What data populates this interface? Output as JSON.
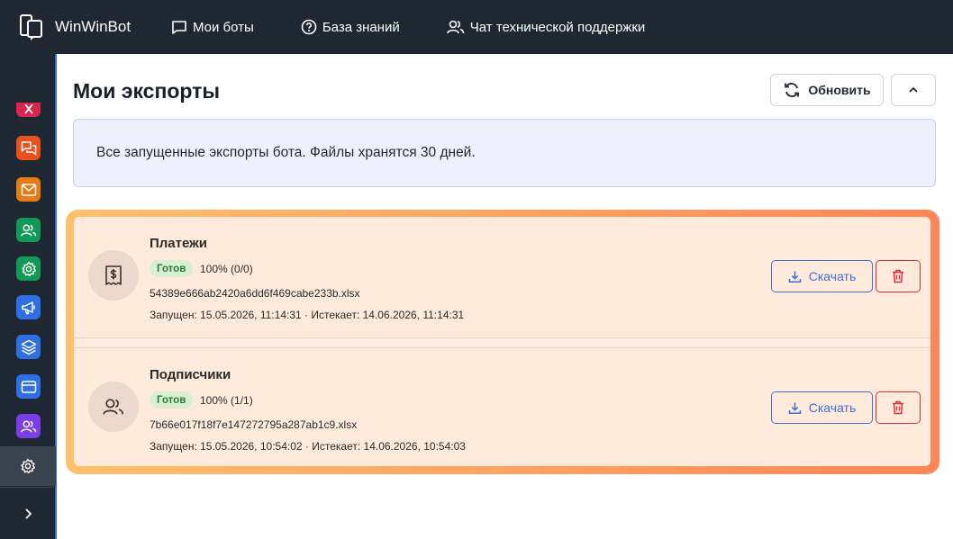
{
  "app": {
    "name": "WinWinBot"
  },
  "nav": [
    {
      "label": "Мои боты",
      "icon": "chat-bubble-icon"
    },
    {
      "label": "База знаний",
      "icon": "question-circle-icon"
    },
    {
      "label": "Чат технической поддержки",
      "icon": "users-icon"
    }
  ],
  "sidebar": {
    "items": [
      {
        "icon": "close-icon",
        "color": "#d9254d"
      },
      {
        "icon": "chats-icon",
        "color": "#e8501c"
      },
      {
        "icon": "mail-icon",
        "color": "#e87a14"
      },
      {
        "icon": "users-icon",
        "color": "#119a55"
      },
      {
        "icon": "gear-icon",
        "color": "#119a55"
      },
      {
        "icon": "megaphone-icon",
        "color": "#2f6fe4"
      },
      {
        "icon": "layers-icon",
        "color": "#2f6fe4"
      },
      {
        "icon": "card-icon",
        "color": "#2f6fe4"
      },
      {
        "icon": "users-icon",
        "color": "#7a3de8"
      }
    ],
    "active_icon": "gear-icon",
    "expand_icon": "chevron-right-icon"
  },
  "page": {
    "title": "Мои экспорты",
    "refresh_label": "Обновить",
    "collapse_icon": "chevron-up-icon",
    "info_text": "Все запущенные экспорты бота. Файлы хранятся 30 дней."
  },
  "exports": [
    {
      "title": "Платежи",
      "icon": "receipt-dollar-icon",
      "status": "Готов",
      "progress": "100% (0/0)",
      "filename": "54389e666ab2420a6dd6f469cabe233b.xlsx",
      "dates": "Запущен: 15.05.2026, 11:14:31 · Истекает: 14.06.2026, 11:14:31",
      "download_label": "Скачать"
    },
    {
      "title": "Подписчики",
      "icon": "users-icon",
      "status": "Готов",
      "progress": "100% (1/1)",
      "filename": "7b66e017f18f7e147272795a287ab1c9.xlsx",
      "dates": "Запущен: 15.05.2026, 10:54:02 · Истекает: 14.06.2026, 10:54:03",
      "download_label": "Скачать"
    }
  ],
  "colors": {
    "topbar": "#1f2733",
    "accent_blue": "#3d6fd4",
    "delete_red": "#d9303a",
    "status_green": "#2c7a34"
  }
}
